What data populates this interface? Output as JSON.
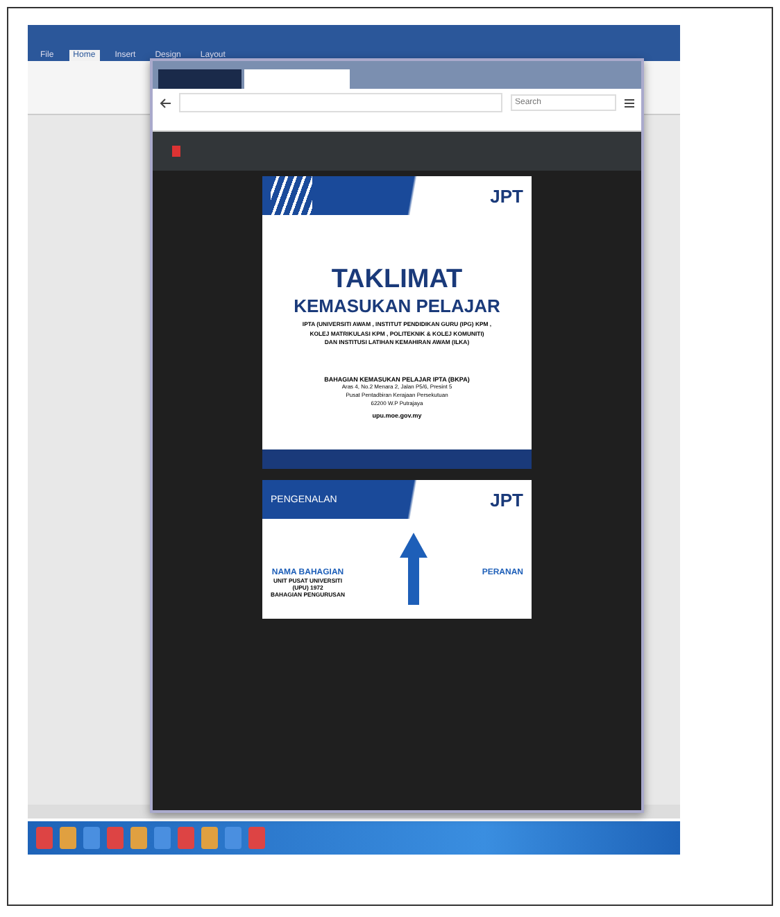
{
  "word": {
    "tabs": [
      {
        "label": "File",
        "selected": false
      },
      {
        "label": "Home",
        "selected": true
      },
      {
        "label": "Insert",
        "selected": false
      },
      {
        "label": "Design",
        "selected": false
      },
      {
        "label": "Layout",
        "selected": false
      }
    ]
  },
  "browser": {
    "tabs": [
      {
        "selected": false
      },
      {
        "selected": true
      }
    ],
    "search": {
      "placeholder": "Search"
    }
  },
  "pdf": {
    "slides": [
      {
        "kind": "title",
        "brand": "JPT",
        "title": "TAKLIMAT",
        "subtitle": "KEMASUKAN PELAJAR",
        "lines": [
          "IPTA (UNIVERSITI AWAM , INSTITUT PENDIDIKAN GURU (IPG) KPM ,",
          "KOLEJ MATRIKULASI KPM , POLITEKNIK & KOLEJ KOMUNITI)",
          "DAN INSTITUSI LATIHAN KEMAHIRAN AWAM (ILKA)"
        ],
        "org": "BAHAGIAN KEMASUKAN PELAJAR IPTA (BKPA)",
        "address": [
          "Aras 4, No.2 Menara 2, Jalan P5/6, Presint 5",
          "Pusat Pentadbiran Kerajaan Persekutuan",
          "62200 W.P Putrajaya"
        ],
        "web": "upu.moe.gov.my"
      },
      {
        "kind": "section",
        "brand": "JPT",
        "title": "PENGENALAN",
        "left_head": "NAMA BAHAGIAN",
        "left_lines": [
          "UNIT PUSAT UNIVERSITI",
          "(UPU) 1972",
          "BAHAGIAN PENGURUSAN"
        ],
        "right_head": "PERANAN"
      }
    ]
  }
}
